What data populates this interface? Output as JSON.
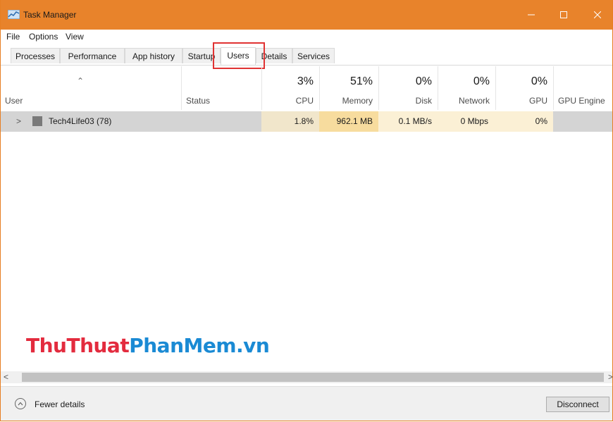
{
  "window": {
    "title": "Task Manager",
    "accent": "#e8832b"
  },
  "menu": [
    "File",
    "Options",
    "View"
  ],
  "tabs": [
    {
      "label": "Processes"
    },
    {
      "label": "Performance"
    },
    {
      "label": "App history"
    },
    {
      "label": "Startup"
    },
    {
      "label": "Users",
      "active": true
    },
    {
      "label": "Details"
    },
    {
      "label": "Services"
    }
  ],
  "columns": {
    "user": {
      "label": "User"
    },
    "status": {
      "label": "Status"
    },
    "cpu": {
      "pct": "3%",
      "label": "CPU"
    },
    "memory": {
      "pct": "51%",
      "label": "Memory"
    },
    "disk": {
      "pct": "0%",
      "label": "Disk"
    },
    "network": {
      "pct": "0%",
      "label": "Network"
    },
    "gpu": {
      "pct": "0%",
      "label": "GPU"
    },
    "gpu_engine": {
      "label": "GPU Engine"
    }
  },
  "rows": [
    {
      "user": "Tech4Life03 (78)",
      "status": "",
      "cpu": "1.8%",
      "memory": "962.1 MB",
      "disk": "0.1 MB/s",
      "network": "0 Mbps",
      "gpu": "0%",
      "gpu_engine": ""
    }
  ],
  "footer": {
    "fewer_details": "Fewer details",
    "disconnect": "Disconnect"
  },
  "watermark": {
    "part1": "ThuThuat",
    "part2": "PhanMem.vn"
  },
  "icons": {
    "app": "task-manager-icon",
    "expand": "chevron-right-icon",
    "user": "user-icon",
    "sort": "caret-up-icon",
    "fewer": "chevron-up-circle-icon"
  }
}
